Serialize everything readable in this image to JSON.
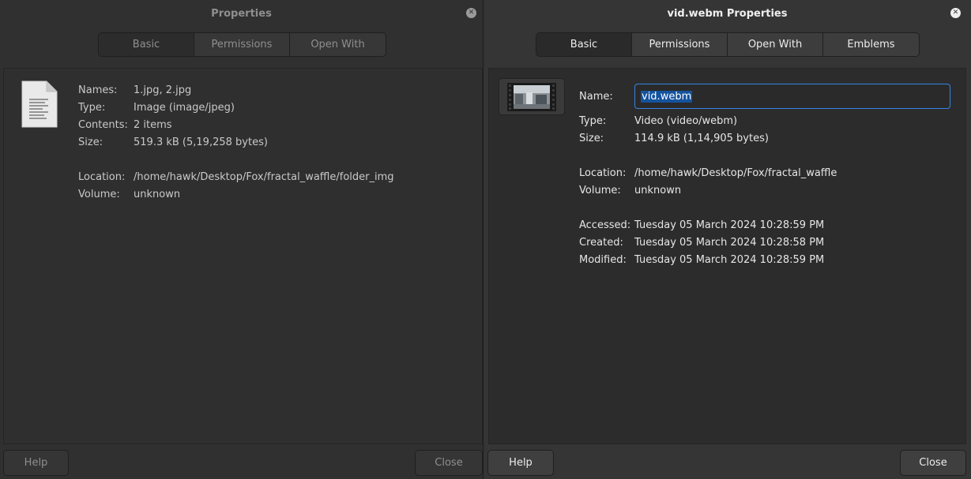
{
  "left_window": {
    "title": "Properties",
    "tabs": [
      "Basic",
      "Permissions",
      "Open With"
    ],
    "fields": {
      "names_label": "Names:",
      "names_value": "1.jpg, 2.jpg",
      "type_label": "Type:",
      "type_value": "Image (image/jpeg)",
      "contents_label": "Contents:",
      "contents_value": "2 items",
      "size_label": "Size:",
      "size_value": "519.3 kB (5,19,258 bytes)",
      "location_label": "Location:",
      "location_value": "/home/hawk/Desktop/Fox/fractal_waffle/folder_img",
      "volume_label": "Volume:",
      "volume_value": "unknown"
    },
    "help_label": "Help",
    "close_label": "Close",
    "icon": "text-document-icon"
  },
  "right_window": {
    "title": "vid.webm Properties",
    "tabs": [
      "Basic",
      "Permissions",
      "Open With",
      "Emblems"
    ],
    "name_label": "Name:",
    "name_value": "vid.webm",
    "fields": {
      "type_label": "Type:",
      "type_value": "Video (video/webm)",
      "size_label": "Size:",
      "size_value": "114.9 kB (1,14,905 bytes)",
      "location_label": "Location:",
      "location_value": "/home/hawk/Desktop/Fox/fractal_waffle",
      "volume_label": "Volume:",
      "volume_value": "unknown",
      "accessed_label": "Accessed:",
      "accessed_value": "Tuesday 05 March 2024 10:28:59 PM",
      "created_label": "Created:",
      "created_value": "Tuesday 05 March 2024 10:28:58 PM",
      "modified_label": "Modified:",
      "modified_value": "Tuesday 05 March 2024 10:28:59 PM"
    },
    "help_label": "Help",
    "close_label": "Close",
    "icon": "video-thumbnail-icon"
  },
  "colors": {
    "accent": "#3584e4",
    "selection": "#15539e",
    "background": "#303030"
  }
}
